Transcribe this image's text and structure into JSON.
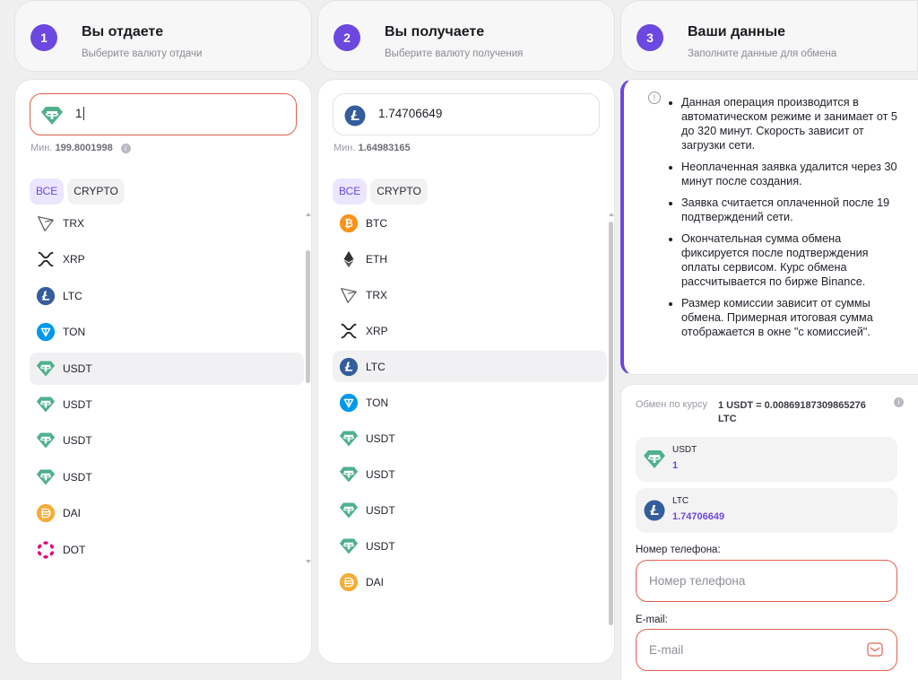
{
  "steps": [
    {
      "num": "1",
      "title": "Вы отдаете",
      "subtitle": "Выберите валюту отдачи"
    },
    {
      "num": "2",
      "title": "Вы получаете",
      "subtitle": "Выберите валюту получения"
    },
    {
      "num": "3",
      "title": "Ваши данные",
      "subtitle": "Заполните данные для обмена"
    }
  ],
  "give": {
    "amount": "1",
    "min_label": "Мин.",
    "min_value": "199.8001998",
    "filters": [
      "ВСЕ",
      "CRYPTO"
    ],
    "items": [
      {
        "label": "TRX",
        "icon": "trx-icon"
      },
      {
        "label": "XRP",
        "icon": "xrp-icon"
      },
      {
        "label": "LTC",
        "icon": "ltc-icon"
      },
      {
        "label": "TON",
        "icon": "ton-icon"
      },
      {
        "label": "USDT",
        "icon": "usdt-icon",
        "selected": true
      },
      {
        "label": "USDT",
        "icon": "usdt-icon"
      },
      {
        "label": "USDT",
        "icon": "usdt-icon"
      },
      {
        "label": "USDT",
        "icon": "usdt-icon"
      },
      {
        "label": "DAI",
        "icon": "dai-icon"
      },
      {
        "label": "DOT",
        "icon": "dot-icon"
      }
    ]
  },
  "receive": {
    "amount": "1.74706649",
    "min_label": "Мин.",
    "min_value": "1.64983165",
    "filters": [
      "ВСЕ",
      "CRYPTO"
    ],
    "items": [
      {
        "label": "BTC",
        "icon": "btc-icon"
      },
      {
        "label": "ETH",
        "icon": "eth-icon"
      },
      {
        "label": "TRX",
        "icon": "trx-icon"
      },
      {
        "label": "XRP",
        "icon": "xrp-icon"
      },
      {
        "label": "LTC",
        "icon": "ltc-icon",
        "selected": true
      },
      {
        "label": "TON",
        "icon": "ton-icon"
      },
      {
        "label": "USDT",
        "icon": "usdt-icon"
      },
      {
        "label": "USDT",
        "icon": "usdt-icon"
      },
      {
        "label": "USDT",
        "icon": "usdt-icon"
      },
      {
        "label": "USDT",
        "icon": "usdt-icon"
      },
      {
        "label": "DAI",
        "icon": "dai-icon"
      }
    ]
  },
  "info": {
    "bullets": [
      "Данная операция производится в автоматическом режиме и занимает от 5 до 320 минут. Скорость зависит от загрузки сети.",
      "Неоплаченная заявка удалится через 30 минут после создания.",
      "Заявка считается оплаченной после 19 подтверждений сети.",
      "Окончательная сумма обмена фиксируется после подтверждения оплаты сервисом. Курс обмена рассчитывается по бирже Binance.",
      "Размер комиссии зависит от суммы обмена. Примерная итоговая сумма отображается в окне \"с комиссией\"."
    ]
  },
  "form": {
    "rate_label": "Обмен по курсу",
    "rate_value": "1 USDT = 0.00869187309865276 LTC",
    "give_currency": "USDT",
    "give_amount": "1",
    "receive_currency": "LTC",
    "receive_amount": "1.74706649",
    "phone_label": "Номер телефона:",
    "phone_placeholder": "Номер телефона",
    "email_label": "E-mail:",
    "email_placeholder": "E-mail"
  },
  "colors": {
    "accent": "#6c47e0",
    "error_border": "#e0604e",
    "usdt": "#4fb08c",
    "ltc": "#345d9d",
    "ton": "#0098ea",
    "btc": "#f7931a",
    "dai": "#f5ac37",
    "dot": "#e6007a"
  }
}
